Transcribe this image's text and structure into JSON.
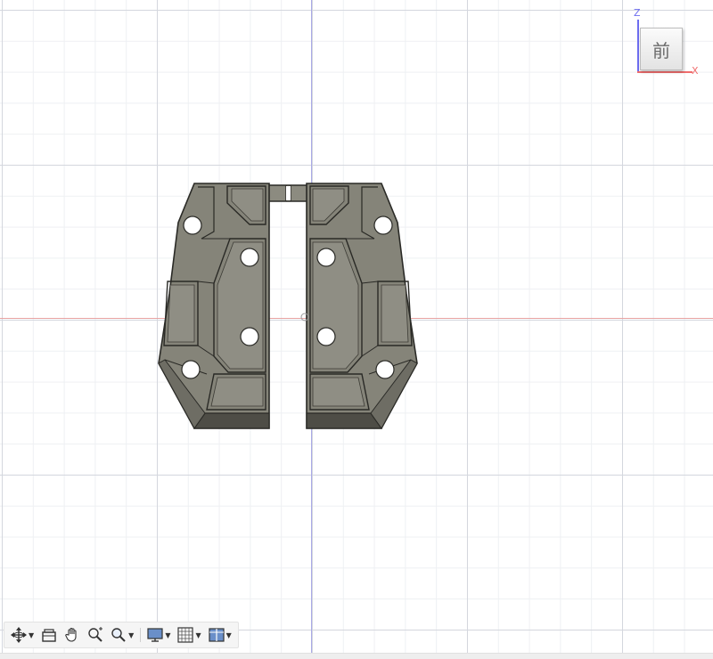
{
  "view_cube": {
    "face_label": "前",
    "z_axis_label": "Z",
    "x_axis_label": "X"
  },
  "colors": {
    "grid_major": "#d4d7de",
    "grid_minor": "#eef0f3",
    "x_axis": "#e7a2a2",
    "z_axis": "#a9a9e6",
    "part_face": "#858479",
    "part_outline": "#2a2a26",
    "part_bottom": "#4e4d46",
    "toolbar_bg": "#f5f5f5"
  },
  "model": {
    "part_count": 2,
    "hole_count_per_part": 4,
    "hinge_pin": true
  },
  "toolbar": {
    "items": [
      {
        "icon": "orbit-icon",
        "dropdown": true
      },
      {
        "icon": "look-at-icon",
        "dropdown": false
      },
      {
        "icon": "pan-hand-icon",
        "dropdown": false
      },
      {
        "icon": "zoom-icon",
        "dropdown": false
      },
      {
        "icon": "zoom-window-icon",
        "dropdown": true
      },
      {
        "icon": "display-settings-icon",
        "dropdown": true
      },
      {
        "icon": "grid-settings-icon",
        "dropdown": true
      },
      {
        "icon": "viewports-icon",
        "dropdown": true
      }
    ]
  }
}
